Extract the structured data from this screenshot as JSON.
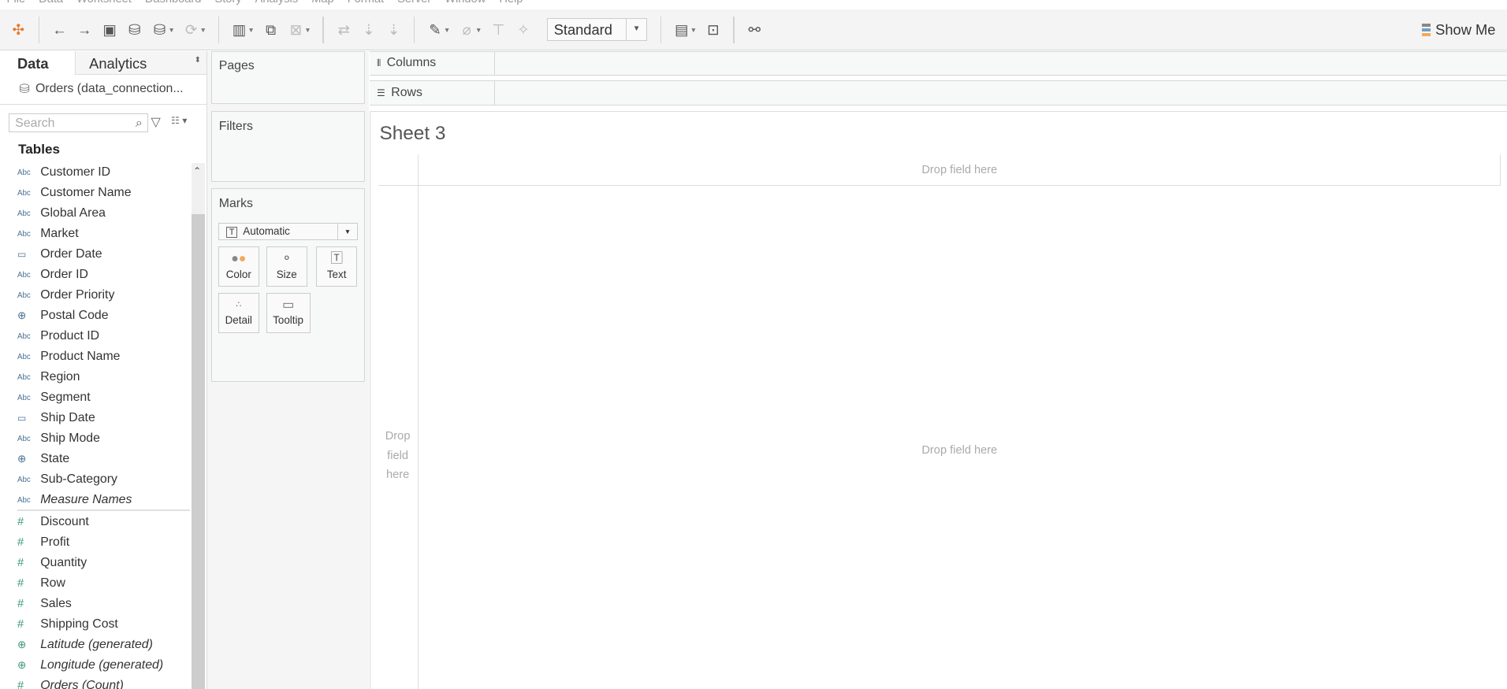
{
  "menu": [
    "File",
    "Data",
    "Worksheet",
    "Dashboard",
    "Story",
    "Analysis",
    "Map",
    "Format",
    "Server",
    "Window",
    "Help"
  ],
  "toolbar": {
    "fit": "Standard",
    "show_me": "Show Me"
  },
  "left": {
    "tab_data": "Data",
    "tab_analytics": "Analytics",
    "connection": "Orders (data_connection...",
    "search_placeholder": "Search",
    "tables": "Tables",
    "dimensions": [
      {
        "name": "Customer ID",
        "type": "Abc"
      },
      {
        "name": "Customer Name",
        "type": "Abc"
      },
      {
        "name": "Global Area",
        "type": "Abc"
      },
      {
        "name": "Market",
        "type": "Abc"
      },
      {
        "name": "Order Date",
        "type": "date"
      },
      {
        "name": "Order ID",
        "type": "Abc"
      },
      {
        "name": "Order Priority",
        "type": "Abc"
      },
      {
        "name": "Postal Code",
        "type": "geo"
      },
      {
        "name": "Product ID",
        "type": "Abc"
      },
      {
        "name": "Product Name",
        "type": "Abc"
      },
      {
        "name": "Region",
        "type": "Abc"
      },
      {
        "name": "Segment",
        "type": "Abc"
      },
      {
        "name": "Ship Date",
        "type": "date"
      },
      {
        "name": "Ship Mode",
        "type": "Abc"
      },
      {
        "name": "State",
        "type": "geo"
      },
      {
        "name": "Sub-Category",
        "type": "Abc"
      },
      {
        "name": "Measure Names",
        "type": "Abc",
        "italic": true
      }
    ],
    "measures": [
      {
        "name": "Discount",
        "type": "num"
      },
      {
        "name": "Profit",
        "type": "num"
      },
      {
        "name": "Quantity",
        "type": "num"
      },
      {
        "name": "Row",
        "type": "num"
      },
      {
        "name": "Sales",
        "type": "num"
      },
      {
        "name": "Shipping Cost",
        "type": "num"
      },
      {
        "name": "Latitude (generated)",
        "type": "geo",
        "italic": true
      },
      {
        "name": "Longitude (generated)",
        "type": "geo",
        "italic": true
      },
      {
        "name": "Orders (Count)",
        "type": "num",
        "italic": true
      }
    ]
  },
  "cards": {
    "pages": "Pages",
    "filters": "Filters",
    "marks": "Marks",
    "mark_type": "Automatic",
    "color": "Color",
    "size": "Size",
    "text": "Text",
    "detail": "Detail",
    "tooltip": "Tooltip"
  },
  "shelves": {
    "columns": "Columns",
    "rows": "Rows"
  },
  "sheet": {
    "title": "Sheet 3",
    "drop_top": "Drop field here",
    "drop_left": "Drop field here",
    "drop_center": "Drop field here"
  }
}
